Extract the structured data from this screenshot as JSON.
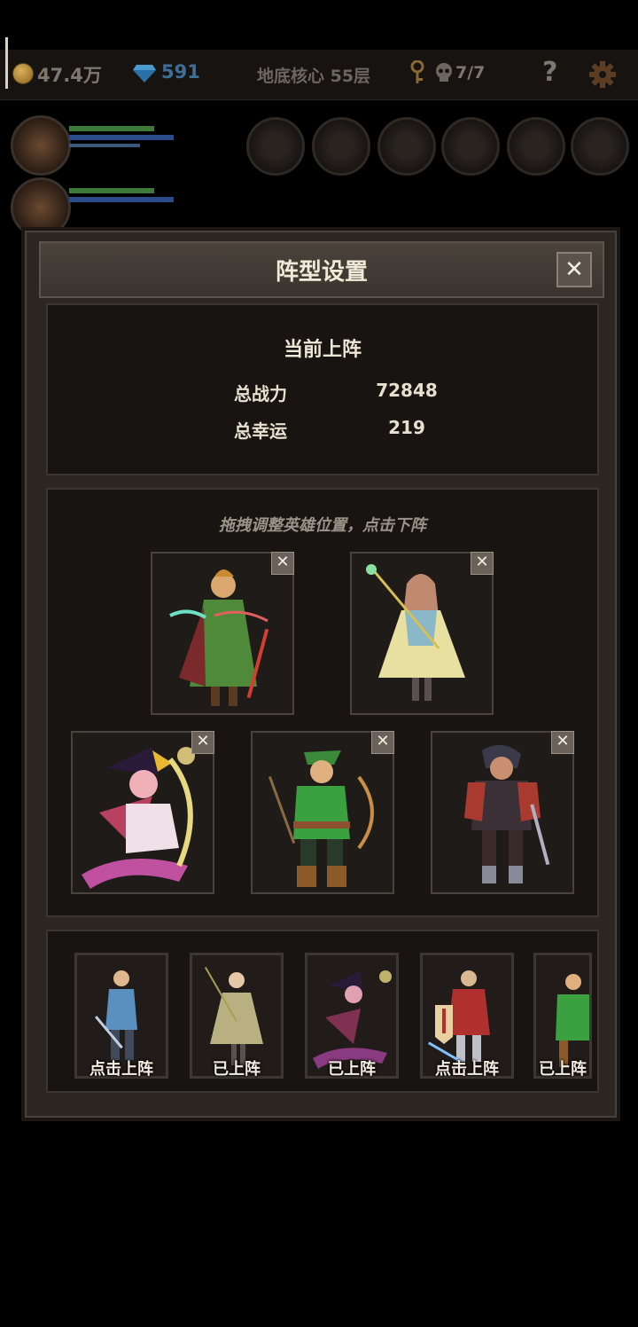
{
  "topbar": {
    "gold": "47.4万",
    "diamonds": "591",
    "dungeon": "地底核心 55层",
    "keys_skulls": "7/7",
    "help": "?"
  },
  "modal": {
    "title": "阵型设置",
    "close": "✕",
    "stats": {
      "heading": "当前上阵",
      "power_label": "总战力",
      "power_value": "72848",
      "luck_label": "总幸运",
      "luck_value": "219"
    },
    "hint": "拖拽调整英雄位置，点击下阵",
    "slot_close": "✕",
    "roster": [
      {
        "label": "点击上阵"
      },
      {
        "label": "已上阵"
      },
      {
        "label": "已上阵"
      },
      {
        "label": "点击上阵"
      },
      {
        "label": "已上阵"
      }
    ]
  }
}
